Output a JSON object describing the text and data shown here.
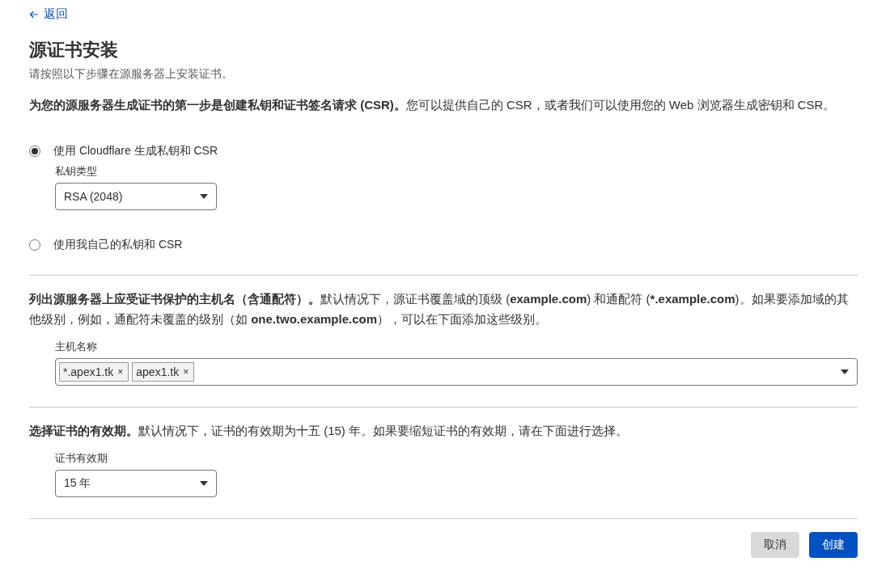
{
  "back_link": {
    "label": "返回"
  },
  "title": "源证书安装",
  "subtitle": "请按照以下步骤在源服务器上安装证书。",
  "csr_section": {
    "text": "**为您的源服务器生成证书的第一步是创建私钥和证书签名请求 (CSR)。**您可以提供自己的 CSR，或者我们可以使用您的 Web 浏览器生成密钥和 CSR。",
    "options": [
      {
        "label": "使用 Cloudflare 生成私钥和 CSR",
        "selected": true,
        "key_type": {
          "label": "私钥类型",
          "value": "RSA (2048)"
        }
      },
      {
        "label": "使用我自己的私钥和 CSR",
        "selected": false
      }
    ]
  },
  "hostnames_section": {
    "text": "**列出源服务器上应受证书保护的主机名（含通配符）。**默认情况下，源证书覆盖域的顶级 (**example.com**) 和通配符 (***.example.com**)。如果要添加域的其他级别，例如，通配符未覆盖的级别（如 **one.two.example.com**），可以在下面添加这些级别。",
    "field_label": "主机名称",
    "tags": [
      {
        "label": "*.apex1.tk",
        "remove": "×"
      },
      {
        "label": "apex1.tk",
        "remove": "×"
      }
    ]
  },
  "validity_section": {
    "text": "**选择证书的有效期。**默认情况下，证书的有效期为十五 (15) 年。如果要缩短证书的有效期，请在下面进行选择。",
    "field_label": "证书有效期",
    "value": "15 年"
  },
  "buttons": [
    {
      "label": "取消",
      "kind": "secondary"
    },
    {
      "label": "创建",
      "kind": "primary"
    }
  ]
}
